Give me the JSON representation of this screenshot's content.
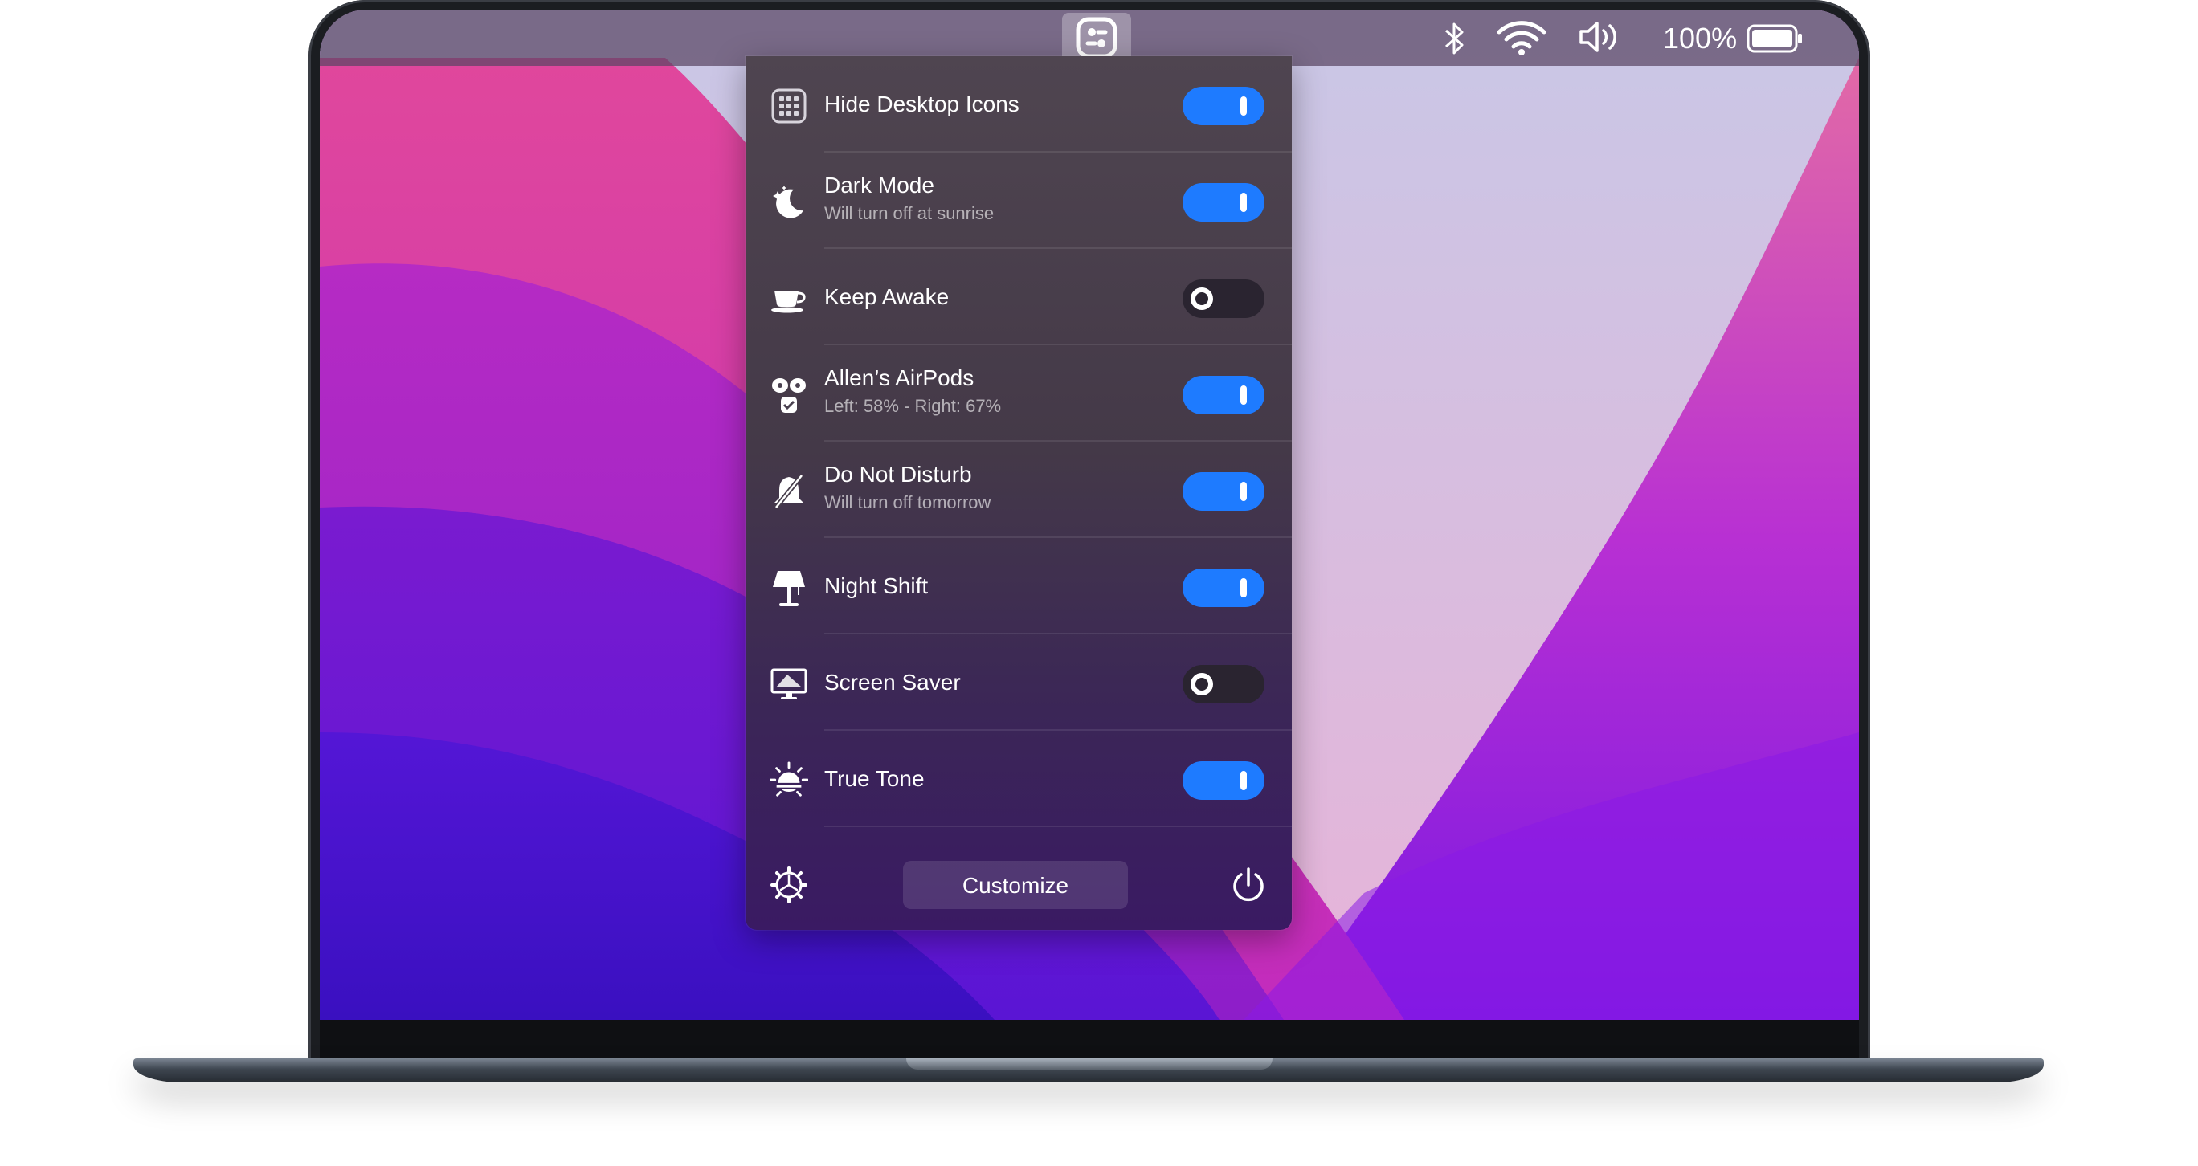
{
  "menubar": {
    "battery_percent": "100%",
    "icons": [
      "app-switch-icon",
      "bluetooth-icon",
      "wifi-icon",
      "volume-icon",
      "battery-icon"
    ]
  },
  "panel": {
    "items": [
      {
        "label": "Hide Desktop Icons",
        "sub": "",
        "icon": "grid-icon",
        "on": true
      },
      {
        "label": "Dark Mode",
        "sub": "Will turn off at sunrise",
        "icon": "moon-icon",
        "on": true
      },
      {
        "label": "Keep Awake",
        "sub": "",
        "icon": "coffee-cup-icon",
        "on": false
      },
      {
        "label": "Allen’s AirPods",
        "sub": "Left: 58% - Right: 67%",
        "icon": "airpods-icon",
        "on": true
      },
      {
        "label": "Do Not Disturb",
        "sub": "Will turn off tomorrow",
        "icon": "bell-slash-icon",
        "on": true
      },
      {
        "label": "Night Shift",
        "sub": "",
        "icon": "lamp-icon",
        "on": true
      },
      {
        "label": "Screen Saver",
        "sub": "",
        "icon": "monitor-icon",
        "on": false
      },
      {
        "label": "True Tone",
        "sub": "",
        "icon": "sun-icon",
        "on": true
      }
    ],
    "footer": {
      "customize_label": "Customize",
      "settings_icon": "gear-icon",
      "power_icon": "power-icon"
    }
  },
  "colors": {
    "toggle_on": "#1e7bff",
    "toggle_off": "#2a2430"
  }
}
